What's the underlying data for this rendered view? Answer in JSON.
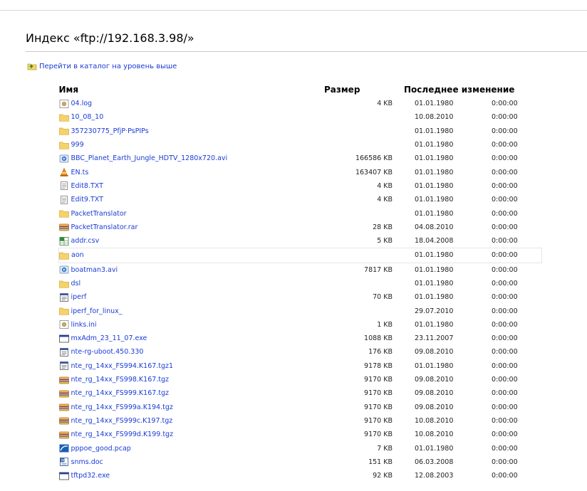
{
  "page": {
    "title": "Индекс «ftp://192.168.3.98/»",
    "parent_link": "Перейти в каталог на уровень выше"
  },
  "columns": {
    "name": "Имя",
    "size": "Размер",
    "modified": "Последнее изменение"
  },
  "files": [
    {
      "name": "04.log",
      "size": "4 KB",
      "date": "01.01.1980",
      "time": "0:00:00",
      "icon": "text-file-icon"
    },
    {
      "name": "10_08_10",
      "size": "",
      "date": "10.08.2010",
      "time": "0:00:00",
      "icon": "folder-icon"
    },
    {
      "name": "357230775_PfjP·PsPIPs",
      "size": "",
      "date": "01.01.1980",
      "time": "0:00:00",
      "icon": "folder-icon"
    },
    {
      "name": "999",
      "size": "",
      "date": "01.01.1980",
      "time": "0:00:00",
      "icon": "folder-icon"
    },
    {
      "name": "BBC_Planet_Earth_Jungle_HDTV_1280x720.avi",
      "size": "166586 KB",
      "date": "01.01.1980",
      "time": "0:00:00",
      "icon": "video-file-icon"
    },
    {
      "name": "EN.ts",
      "size": "163407 KB",
      "date": "01.01.1980",
      "time": "0:00:00",
      "icon": "vlc-file-icon"
    },
    {
      "name": "Edit8.TXT",
      "size": "4 KB",
      "date": "01.01.1980",
      "time": "0:00:00",
      "icon": "document-file-icon"
    },
    {
      "name": "Edit9.TXT",
      "size": "4 KB",
      "date": "01.01.1980",
      "time": "0:00:00",
      "icon": "document-file-icon"
    },
    {
      "name": "PacketTranslator",
      "size": "",
      "date": "01.01.1980",
      "time": "0:00:00",
      "icon": "folder-icon"
    },
    {
      "name": "PacketTranslator.rar",
      "size": "28 KB",
      "date": "04.08.2010",
      "time": "0:00:00",
      "icon": "archive-file-icon"
    },
    {
      "name": "addr.csv",
      "size": "5 KB",
      "date": "18.04.2008",
      "time": "0:00:00",
      "icon": "spreadsheet-file-icon"
    },
    {
      "name": "aon",
      "size": "",
      "date": "01.01.1980",
      "time": "0:00:00",
      "icon": "folder-icon",
      "highlight": true
    },
    {
      "name": "boatman3.avi",
      "size": "7817 KB",
      "date": "01.01.1980",
      "time": "0:00:00",
      "icon": "video-file-icon"
    },
    {
      "name": "dsl",
      "size": "",
      "date": "01.01.1980",
      "time": "0:00:00",
      "icon": "folder-icon"
    },
    {
      "name": "iperf",
      "size": "70 KB",
      "date": "01.01.1980",
      "time": "0:00:00",
      "icon": "binary-file-icon"
    },
    {
      "name": "iperf_for_linux_",
      "size": "",
      "date": "29.07.2010",
      "time": "0:00:00",
      "icon": "folder-icon"
    },
    {
      "name": "links.ini",
      "size": "1 KB",
      "date": "01.01.1980",
      "time": "0:00:00",
      "icon": "text-file-icon"
    },
    {
      "name": "mxAdm_23_11_07.exe",
      "size": "1088 KB",
      "date": "23.11.2007",
      "time": "0:00:00",
      "icon": "exe-file-icon"
    },
    {
      "name": "nte-rg-uboot.450.330",
      "size": "176 KB",
      "date": "09.08.2010",
      "time": "0:00:00",
      "icon": "binary-file-icon"
    },
    {
      "name": "nte_rg_14xx_FS994.K167.tgz1",
      "size": "9178 KB",
      "date": "01.01.1980",
      "time": "0:00:00",
      "icon": "binary-file-icon"
    },
    {
      "name": "nte_rg_14xx_FS998.K167.tgz",
      "size": "9170 KB",
      "date": "09.08.2010",
      "time": "0:00:00",
      "icon": "archive-file-icon"
    },
    {
      "name": "nte_rg_14xx_FS999.K167.tgz",
      "size": "9170 KB",
      "date": "09.08.2010",
      "time": "0:00:00",
      "icon": "archive-file-icon"
    },
    {
      "name": "nte_rg_14xx_FS999a.K194.tgz",
      "size": "9170 KB",
      "date": "09.08.2010",
      "time": "0:00:00",
      "icon": "archive-file-icon"
    },
    {
      "name": "nte_rg_14xx_FS999c.K197.tgz",
      "size": "9170 KB",
      "date": "10.08.2010",
      "time": "0:00:00",
      "icon": "archive-file-icon"
    },
    {
      "name": "nte_rg_14xx_FS999d.K199.tgz",
      "size": "9170 KB",
      "date": "10.08.2010",
      "time": "0:00:00",
      "icon": "archive-file-icon"
    },
    {
      "name": "pppoe_good.pcap",
      "size": "7 KB",
      "date": "01.01.1980",
      "time": "0:00:00",
      "icon": "pcap-file-icon"
    },
    {
      "name": "snms.doc",
      "size": "151 KB",
      "date": "06.03.2008",
      "time": "0:00:00",
      "icon": "word-file-icon"
    },
    {
      "name": "tftpd32.exe",
      "size": "92 KB",
      "date": "12.08.2003",
      "time": "0:00:00",
      "icon": "exe-file-icon"
    }
  ],
  "colors": {
    "link": "#1a3cd6",
    "folder": "#f5d36a"
  }
}
